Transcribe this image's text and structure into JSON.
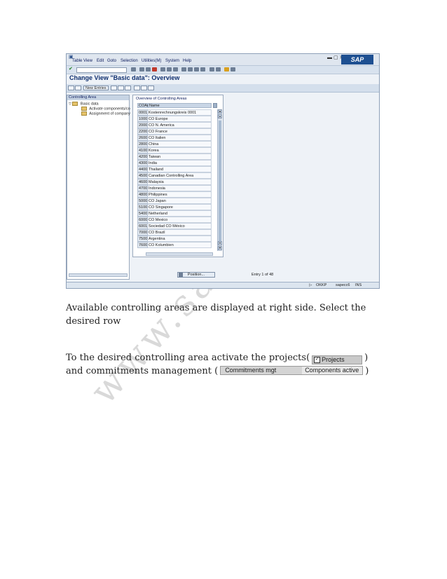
{
  "screenshot": {
    "menu": [
      "Table View",
      "Edit",
      "Goto",
      "Selection",
      "Utilities(M)",
      "System",
      "Help"
    ],
    "logo": "SAP",
    "title": "Change View \"Basic data\": Overview",
    "toolbar_button": "New Entries",
    "nav": {
      "header": "Controlling Area",
      "root": "Basic data",
      "children": [
        "Activate components/co",
        "Assignment of company"
      ]
    },
    "overview": {
      "title": "Overview of Controlling Areas",
      "col_code": "COAr",
      "col_name": "Name",
      "rows": [
        {
          "code": "0001",
          "name": "Kostenrechnungskreis 0001"
        },
        {
          "code": "1000",
          "name": "CO Europe"
        },
        {
          "code": "2000",
          "name": "CO N. America"
        },
        {
          "code": "2200",
          "name": "CO France"
        },
        {
          "code": "2600",
          "name": "CO Italien"
        },
        {
          "code": "2800",
          "name": "China"
        },
        {
          "code": "4100",
          "name": "Korea"
        },
        {
          "code": "4200",
          "name": "Taiwan"
        },
        {
          "code": "4300",
          "name": "India"
        },
        {
          "code": "4400",
          "name": "Thailand"
        },
        {
          "code": "4500",
          "name": "Canadian Controlling Area"
        },
        {
          "code": "4600",
          "name": "Malaysia"
        },
        {
          "code": "4700",
          "name": "Indonesia"
        },
        {
          "code": "4800",
          "name": "Philippines"
        },
        {
          "code": "5000",
          "name": "CO Japan"
        },
        {
          "code": "5100",
          "name": "CO Singapore"
        },
        {
          "code": "5400",
          "name": "Netherland"
        },
        {
          "code": "6000",
          "name": "CO Mexico"
        },
        {
          "code": "6001",
          "name": "Sociedad CO México"
        },
        {
          "code": "7000",
          "name": "CO Brazil"
        },
        {
          "code": "7500",
          "name": "Argentina"
        },
        {
          "code": "7600",
          "name": "CO Kolumbien"
        }
      ]
    },
    "position_button": "Position...",
    "entry_info": "Entry 1 of 48",
    "status": {
      "tcode": "OKKP",
      "server": "sapecc6",
      "mode": "INS"
    }
  },
  "text": {
    "para1": "Available controlling areas are displayed at right side. Select the desired row",
    "para2_a": "To the desired controlling area activate the projects(",
    "para2_b": ")",
    "para3_a": "and commitments management (",
    "para3_b": ")",
    "projects_label": "Projects",
    "commit_label": "Commitments mgt",
    "components_label": "Components active"
  },
  "watermark": "www.sap-te"
}
